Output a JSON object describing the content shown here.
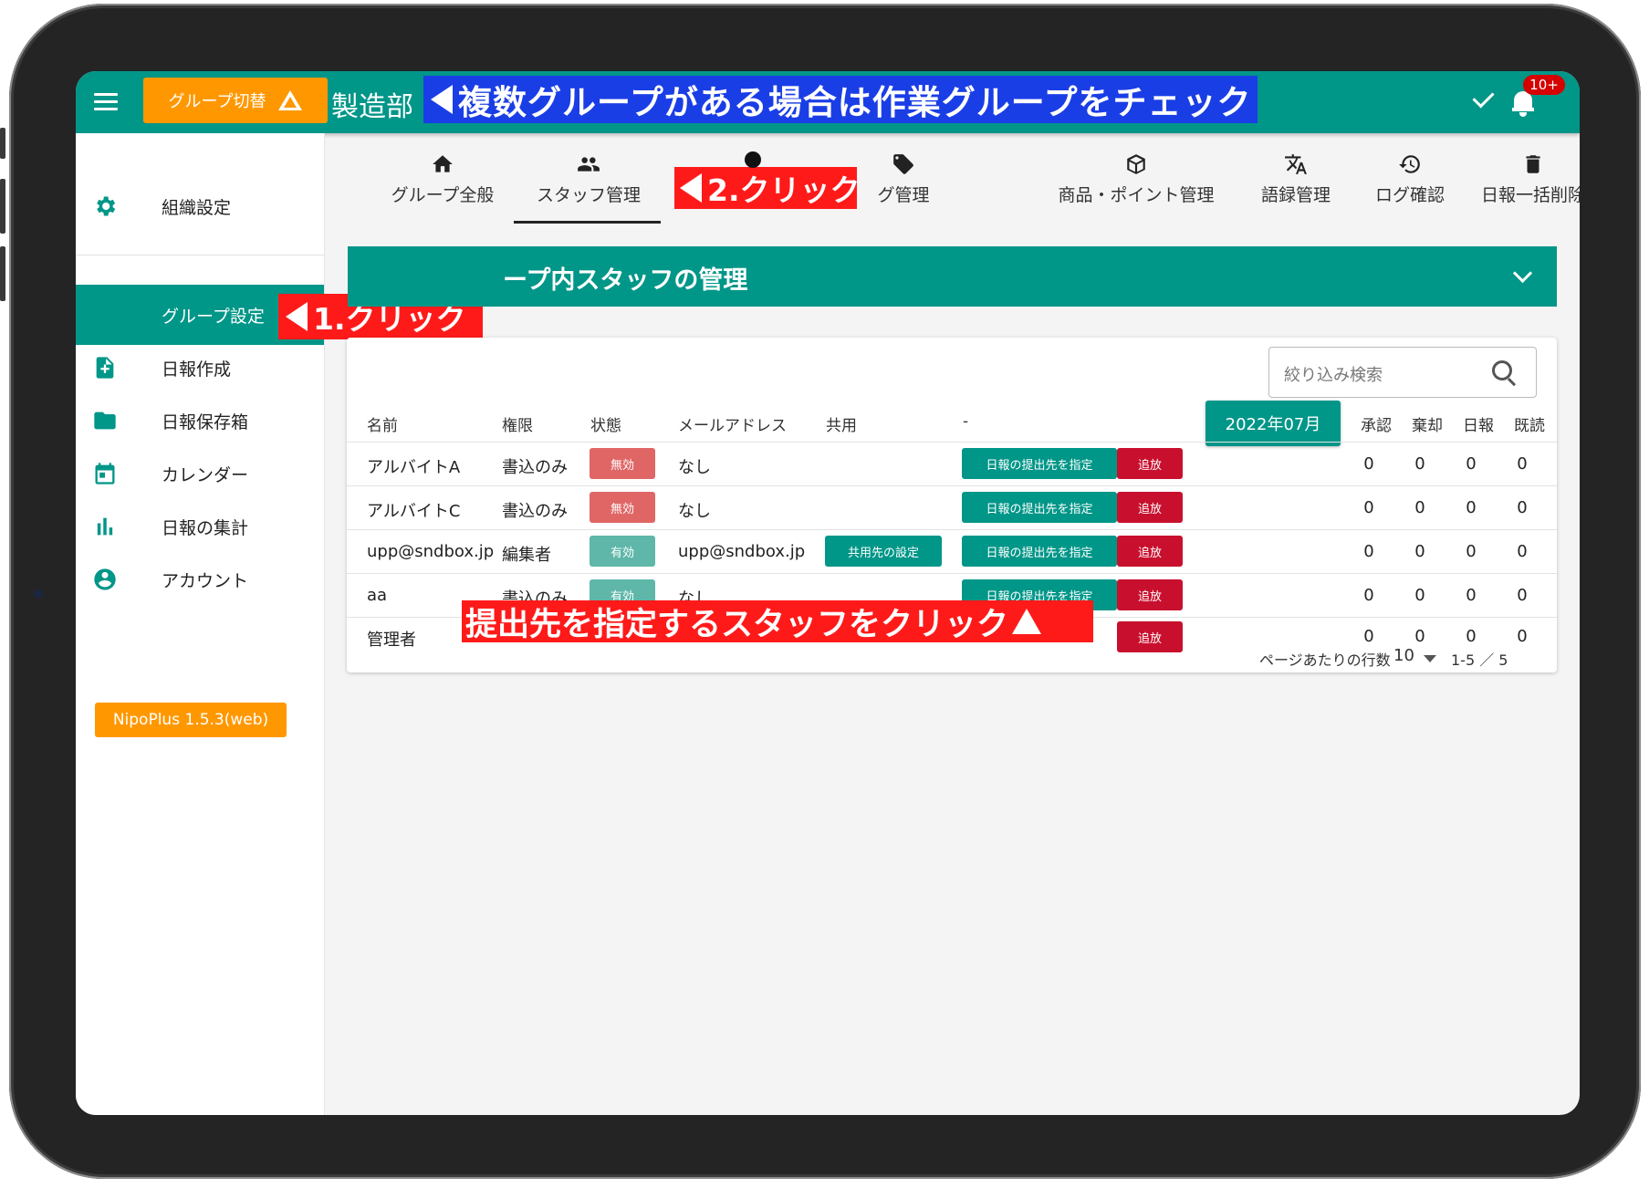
{
  "appbar": {
    "group_switch_label": "グループ切替",
    "group_name": "製造部",
    "annotation": "複数グループがある場合は作業グループをチェック",
    "notification_badge": "10+"
  },
  "sidebar": {
    "items": [
      {
        "label": "組織設定",
        "icon": "gear-icon"
      },
      {
        "label": "グループ設定",
        "icon": "none"
      },
      {
        "label": "日報作成",
        "icon": "file-plus-icon"
      },
      {
        "label": "日報保存箱",
        "icon": "folder-icon"
      },
      {
        "label": "カレンダー",
        "icon": "calendar-icon"
      },
      {
        "label": "日報の集計",
        "icon": "bar-chart-icon"
      },
      {
        "label": "アカウント",
        "icon": "account-circle-icon"
      }
    ],
    "version": "NipoPlus 1.5.3(web)",
    "annotation": "1.クリック"
  },
  "tabs": [
    {
      "label": "グループ全般",
      "icon": "home-icon"
    },
    {
      "label": "スタッフ管理",
      "icon": "people-icon"
    },
    {
      "label": "グ管理",
      "icon": "tag-icon"
    },
    {
      "label": "商品・ポイント管理",
      "icon": "box-icon"
    },
    {
      "label": "語録管理",
      "icon": "translate-icon"
    },
    {
      "label": "ログ確認",
      "icon": "history-icon"
    },
    {
      "label": "日報一括削除",
      "icon": "trash-icon"
    }
  ],
  "tab_annotation": "2.クリック",
  "section": {
    "title": "ープ内スタッフの管理"
  },
  "table": {
    "search_placeholder": "絞り込み検索",
    "month_button": "2022年07月",
    "headers": {
      "name": "名前",
      "role": "権限",
      "status": "状態",
      "email": "メールアドレス",
      "shared": "共用",
      "dash": "-",
      "approve": "承認",
      "reject": "棄却",
      "report": "日報",
      "read": "既読"
    },
    "rows": [
      {
        "name": "アルバイトA",
        "role": "書込のみ",
        "status": "無効",
        "email": "なし",
        "shared": "",
        "submit": "日報の提出先を指定",
        "expel": "追放",
        "approve": "0",
        "reject": "0",
        "report": "0",
        "read": "0"
      },
      {
        "name": "アルバイトC",
        "role": "書込のみ",
        "status": "無効",
        "email": "なし",
        "shared": "",
        "submit": "日報の提出先を指定",
        "expel": "追放",
        "approve": "0",
        "reject": "0",
        "report": "0",
        "read": "0"
      },
      {
        "name": "upp@sndbox.jp",
        "role": "編集者",
        "status": "有効",
        "email": "upp@sndbox.jp",
        "shared": "共用先の設定",
        "submit": "日報の提出先を指定",
        "expel": "追放",
        "approve": "0",
        "reject": "0",
        "report": "0",
        "read": "0"
      },
      {
        "name": "aa",
        "role": "書込のみ",
        "status": "有効",
        "email": "なし",
        "shared": "",
        "submit": "日報の提出先を指定",
        "expel": "追放",
        "approve": "0",
        "reject": "0",
        "report": "0",
        "read": "0"
      },
      {
        "name": "管理者",
        "role": "",
        "status": "",
        "email": "",
        "shared": "",
        "submit": "",
        "expel": "追放",
        "approve": "0",
        "reject": "0",
        "report": "0",
        "read": "0"
      }
    ],
    "row_annotation": "提出先を指定するスタッフをクリック",
    "rows_per_page_label": "ページあたりの行数",
    "rows_per_page_value": "10",
    "pagination": "1-5 ／ 5"
  },
  "colors": {
    "primary": "#009688",
    "accent": "#ff9800",
    "danger": "#c8102e",
    "inactive_chip": "#e06666",
    "active_chip": "#5fb7a9",
    "annotation_red": "#ff1a1a",
    "annotation_blue": "#1a3ee6"
  }
}
